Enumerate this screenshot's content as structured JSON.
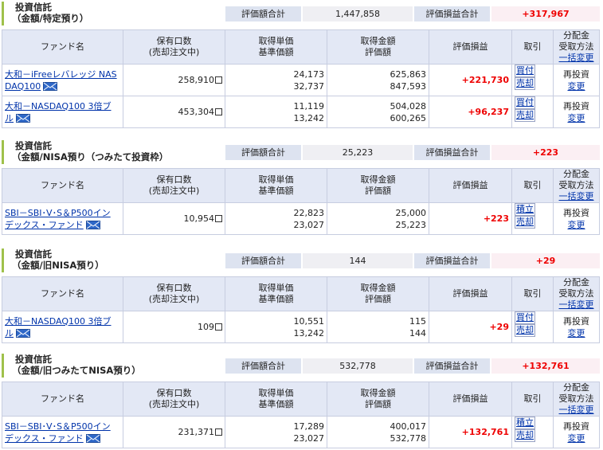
{
  "headers": {
    "fund": "ファンド名",
    "qty1": "保有口数",
    "qty2": "(売却注文中)",
    "cost1": "取得単価",
    "cost2": "基準価額",
    "amt1": "取得金額",
    "amt2": "評価額",
    "pl": "評価損益",
    "trade": "取引",
    "div1": "分配金",
    "div2": "受取方法",
    "div3": "一括変更"
  },
  "summary_labels": {
    "valuation_total": "評価額合計",
    "pl_total": "評価損益合計"
  },
  "sections": [
    {
      "title1": "投資信託",
      "title2": "（金額/特定預り）",
      "valuation_total": "1,447,858",
      "pl_total": "+317,967",
      "rows": [
        {
          "fund_line1": "大和－iFreeレバレッジ NAS",
          "fund_line2": "DAQ100",
          "qty": "258,910",
          "unit_cost": "24,173",
          "nav": "32,737",
          "cost_amount": "625,863",
          "value": "847,593",
          "pl": "+221,730",
          "btn1": "買付",
          "btn2": "売却",
          "div_method": "再投資",
          "div_change": "変更"
        },
        {
          "fund_line1": "大和－NASDAQ100 3倍ブ",
          "fund_line2": "ル",
          "qty": "453,304",
          "unit_cost": "11,119",
          "nav": "13,242",
          "cost_amount": "504,028",
          "value": "600,265",
          "pl": "+96,237",
          "btn1": "買付",
          "btn2": "売却",
          "div_method": "再投資",
          "div_change": "変更"
        }
      ]
    },
    {
      "title1": "投資信託",
      "title2": "（金額/NISA預り（つみたて投資枠）",
      "valuation_total": "25,223",
      "pl_total": "+223",
      "rows": [
        {
          "fund_line1": "SBI－SBI･V･S＆P500イン",
          "fund_line2": "デックス・ファンド",
          "qty": "10,954",
          "unit_cost": "22,823",
          "nav": "23,027",
          "cost_amount": "25,000",
          "value": "25,223",
          "pl": "+223",
          "btn1": "積立",
          "btn2": "売却",
          "div_method": "再投資",
          "div_change": "変更"
        }
      ]
    },
    {
      "title1": "投資信託",
      "title2": "（金額/旧NISA預り）",
      "valuation_total": "144",
      "pl_total": "+29",
      "rows": [
        {
          "fund_line1": "大和－NASDAQ100 3倍ブ",
          "fund_line2": "ル",
          "qty": "109",
          "unit_cost": "10,551",
          "nav": "13,242",
          "cost_amount": "115",
          "value": "144",
          "pl": "+29",
          "btn1": "買付",
          "btn2": "売却",
          "div_method": "再投資",
          "div_change": "変更"
        }
      ]
    },
    {
      "title1": "投資信託",
      "title2": "（金額/旧つみたてNISA預り）",
      "valuation_total": "532,778",
      "pl_total": "+132,761",
      "rows": [
        {
          "fund_line1": "SBI－SBI･V･S＆P500イン",
          "fund_line2": "デックス・ファンド",
          "qty": "231,371",
          "unit_cost": "17,289",
          "nav": "23,027",
          "cost_amount": "400,017",
          "value": "532,778",
          "pl": "+132,761",
          "btn1": "積立",
          "btn2": "売却",
          "div_method": "再投資",
          "div_change": "変更"
        }
      ]
    }
  ]
}
